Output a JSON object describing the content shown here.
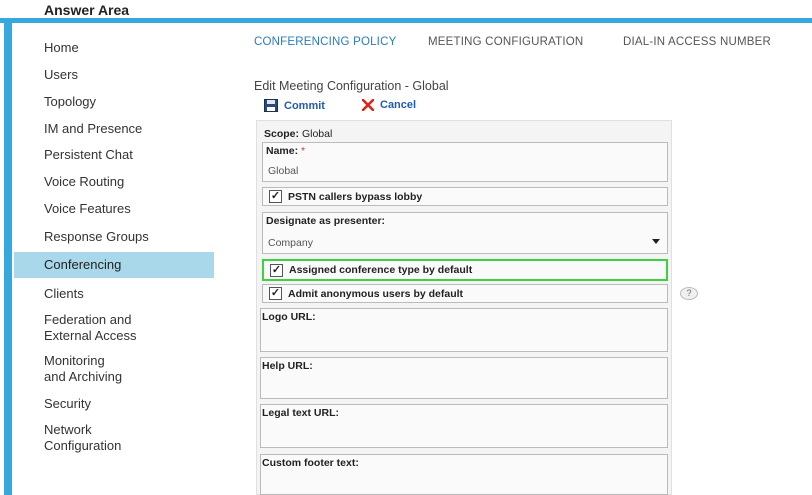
{
  "header": {
    "title": "Answer Area"
  },
  "sidebar": {
    "items": [
      {
        "label": "Home"
      },
      {
        "label": "Users"
      },
      {
        "label": "Topology"
      },
      {
        "label": "IM and Presence"
      },
      {
        "label": "Persistent Chat"
      },
      {
        "label": "Voice Routing"
      },
      {
        "label": "Voice Features"
      },
      {
        "label": "Response Groups"
      },
      {
        "label": "Conferencing",
        "active": true
      },
      {
        "label": "Clients"
      },
      {
        "label": "Federation and\nExternal Access"
      },
      {
        "label": "Monitoring\nand Archiving"
      },
      {
        "label": "Security"
      },
      {
        "label": "Network\nConfiguration"
      }
    ]
  },
  "tabs": [
    {
      "label": "CONFERENCING POLICY",
      "active": true
    },
    {
      "label": "MEETING CONFIGURATION"
    },
    {
      "label": "DIAL-IN ACCESS NUMBER"
    }
  ],
  "page_title": "Edit Meeting Configuration - Global",
  "toolbar": {
    "commit_label": "Commit",
    "cancel_label": "Cancel"
  },
  "form": {
    "scope_label": "Scope:",
    "scope_value": "Global",
    "name_label": "Name:",
    "name_required": "*",
    "name_value": "Global",
    "pstn_bypass_label": "PSTN callers bypass lobby",
    "pstn_bypass_checked": true,
    "designate_label": "Designate as presenter:",
    "designate_value": "Company",
    "assigned_type_label": "Assigned conference type by default",
    "assigned_type_checked": true,
    "admit_anonymous_label": "Admit anonymous users by default",
    "admit_anonymous_checked": true,
    "help_glyph": "?",
    "logo_url_label": "Logo URL:",
    "help_url_label": "Help URL:",
    "legal_text_url_label": "Legal text URL:",
    "custom_footer_label": "Custom footer text:"
  },
  "colors": {
    "accent": "#35a8de",
    "active_nav": "#a8d8ea",
    "highlight": "#3ed33e",
    "link": "#1f5ea8"
  }
}
